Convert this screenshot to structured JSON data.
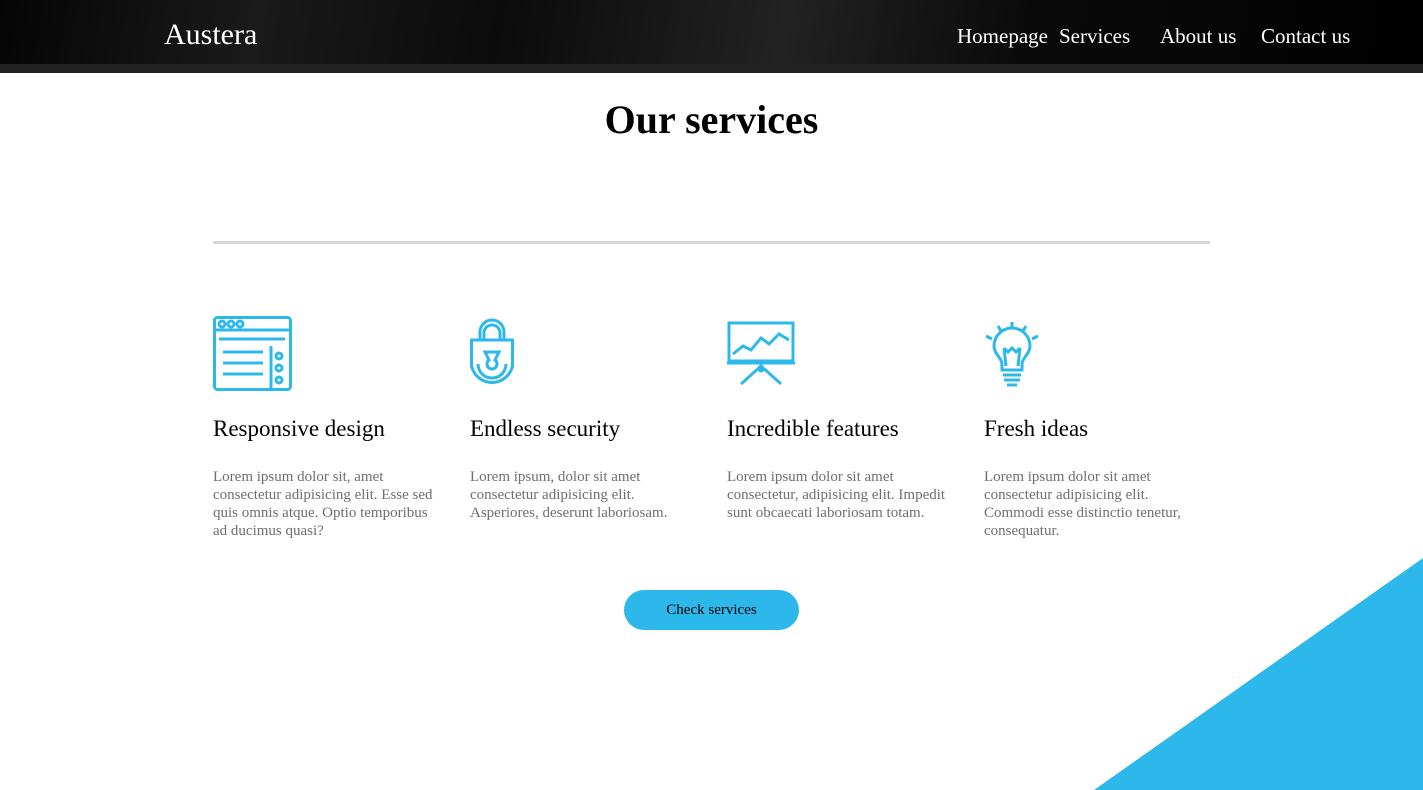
{
  "brand": {
    "name": "Austera"
  },
  "nav": {
    "items": [
      {
        "label": "Homepage"
      },
      {
        "label": "Services"
      },
      {
        "label": "About us"
      },
      {
        "label": "Contact us"
      }
    ]
  },
  "main": {
    "title": "Our services",
    "services": [
      {
        "icon": "browser-window-icon",
        "title": "Responsive design",
        "text": "Lorem ipsum dolor sit, amet consectetur adipisicing elit. Esse sed quis omnis atque. Optio temporibus ad ducimus quasi?"
      },
      {
        "icon": "padlock-icon",
        "title": "Endless security",
        "text": "Lorem ipsum, dolor sit amet consectetur adipisicing elit. Asperiores, deserunt laboriosam."
      },
      {
        "icon": "presentation-chart-icon",
        "title": "Incredible features",
        "text": "Lorem ipsum dolor sit amet consectetur, adipisicing elit. Impedit sunt obcaecati laboriosam totam."
      },
      {
        "icon": "lightbulb-icon",
        "title": "Fresh ideas",
        "text": "Lorem ipsum dolor sit amet consectetur adipisicing elit. Commodi esse distinctio tenetur, consequatur."
      }
    ],
    "cta_label": "Check services"
  },
  "colors": {
    "accent": "#2db8ec",
    "header_bg": "#000000",
    "body_text_muted": "#6f6f6f",
    "divider": "#d6d6d6"
  }
}
